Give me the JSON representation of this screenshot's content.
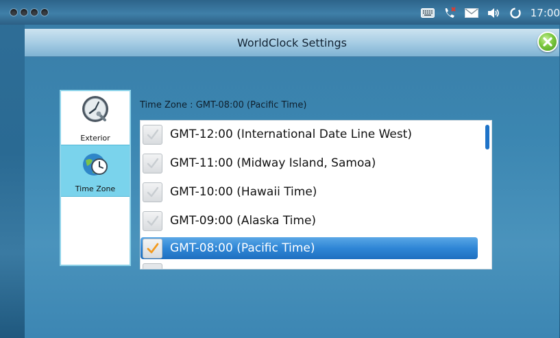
{
  "statusbar": {
    "time": "17:00",
    "icons": [
      "keyboard-icon",
      "missed-call-icon",
      "message-icon",
      "volume-icon",
      "sync-icon"
    ]
  },
  "window": {
    "title": "WorldClock Settings",
    "close_icon": "close-icon"
  },
  "sidebar": {
    "items": [
      {
        "label": "Exterior",
        "icon": "clock-wrench-icon",
        "selected": false
      },
      {
        "label": "Time Zone",
        "icon": "globe-clock-icon",
        "selected": true
      }
    ]
  },
  "timezone": {
    "header": "Time Zone : GMT-08:00 (Pacific Time)",
    "options": [
      {
        "label": "GMT-12:00 (International Date Line West)",
        "checked": false
      },
      {
        "label": "GMT-11:00 (Midway Island, Samoa)",
        "checked": false
      },
      {
        "label": "GMT-10:00 (Hawaii Time)",
        "checked": false
      },
      {
        "label": "GMT-09:00 (Alaska Time)",
        "checked": false
      },
      {
        "label": "GMT-08:00 (Pacific Time)",
        "checked": true
      }
    ]
  },
  "colors": {
    "selection": "#2f86d6",
    "accent_check": "#f39a1e",
    "sidebar_selected": "#7ad3ec"
  }
}
